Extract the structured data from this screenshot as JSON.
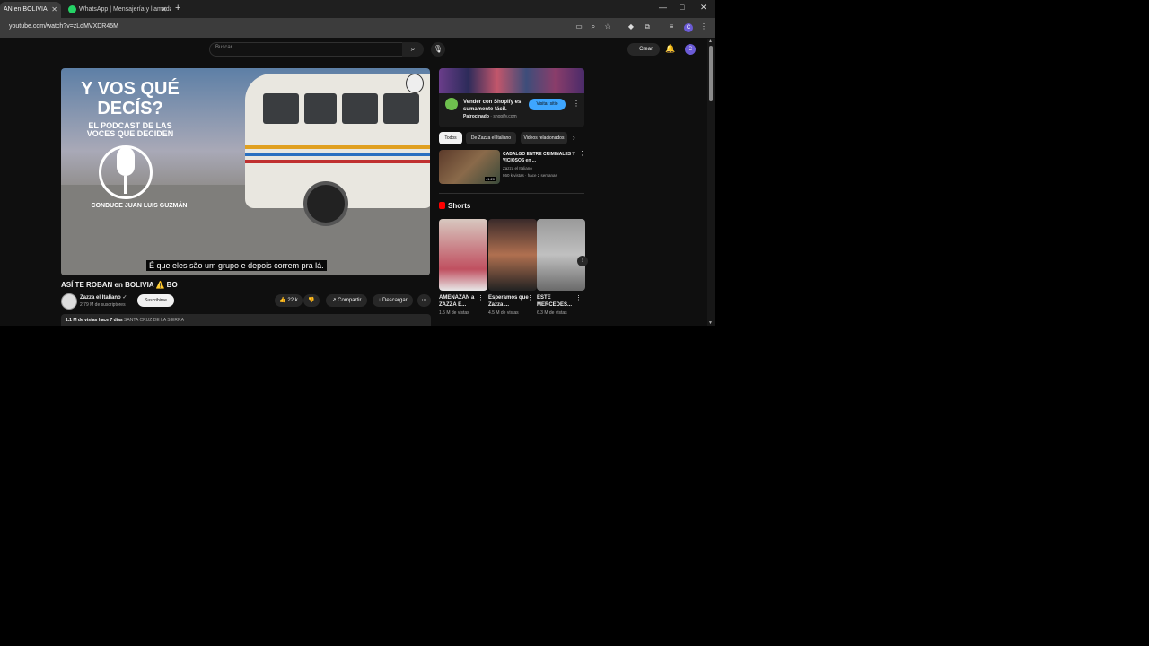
{
  "browser": {
    "tabs": [
      {
        "label": "AN en BOLIVIA",
        "audio_icon": "speaker-icon"
      },
      {
        "label": "WhatsApp | Mensajería y llamadas",
        "icon": "whatsapp-icon"
      }
    ],
    "url": "youtube.com/watch?v=zLdMVXDR45M",
    "profile_initial": "C"
  },
  "yt_header": {
    "search_placeholder": "Buscar",
    "create_label": "Crear",
    "avatar_initial": "C"
  },
  "player": {
    "overlay_title": "Y VOS QUÉ DECÍS?",
    "overlay_subtitle": "EL PODCAST DE LAS VOCES QUE DECIDEN",
    "host": "CONDUCE JUAN LUIS GUZMÁN",
    "caption": "É que eles são um grupo e depois correm pra lá."
  },
  "video": {
    "title": "ASÍ TE ROBAN en BOLIVIA ⚠️ BO",
    "channel": "Zazza el Italiano",
    "subscribers": "2.79 M de suscriptores",
    "subscribe_label": "Suscribirse",
    "likes": "22 k",
    "share_label": "Compartir",
    "download_label": "Descargar",
    "views": "1.1 M de vistas",
    "age": "hace 7 días",
    "location": "SANTA CRUZ DE LA SIERRA"
  },
  "ad": {
    "text": "Vender con Shopify es sumamente fácil.",
    "sponsored": "Patrocinado",
    "domain": "shopify.com",
    "cta": "Visitar sitio"
  },
  "chips": [
    "Todos",
    "De Zazza el Italiano",
    "Videos relacionados"
  ],
  "recommended": {
    "title": "CABALGO ENTRE CRIMINALES Y VICIOSOS en ...",
    "channel": "Zazza el Italiano",
    "meta": "860 k vistas · hace 2 semanas",
    "duration": "41:20"
  },
  "shorts": {
    "heading": "Shorts",
    "items": [
      {
        "title": "AMENAZAN a ZAZZA E...",
        "views": "1.5 M de vistas"
      },
      {
        "title": "Esperamos que Zazza ...",
        "views": "4.5 M de vistas"
      },
      {
        "title": "ESTE MERCEDES...",
        "views": "6.3 M de vistas"
      }
    ]
  },
  "colors": {
    "yt_bg": "#0f0f0f",
    "accent_blue": "#3ea6ff",
    "brand_red": "#ff0000"
  }
}
